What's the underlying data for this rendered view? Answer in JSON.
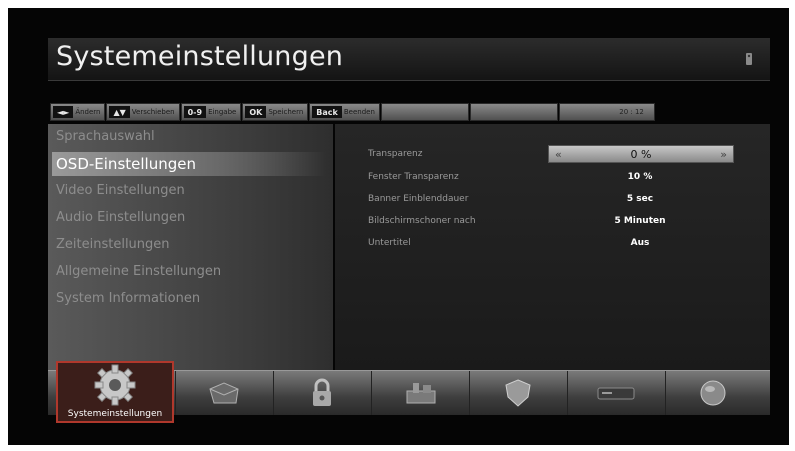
{
  "header": {
    "title": "Systemeinstellungen",
    "corner_icon": "remote-icon"
  },
  "hints": [
    {
      "key": "◄►",
      "label": "Ändern"
    },
    {
      "key": "▲▼",
      "label": "Verschieben"
    },
    {
      "key": "0-9",
      "label": "Eingabe"
    },
    {
      "key": "OK",
      "label": "Speichern"
    },
    {
      "key": "Back",
      "label": "Beenden"
    }
  ],
  "clock": "20 : 12",
  "menu": {
    "items": [
      {
        "label": "Sprachauswahl"
      },
      {
        "label": "OSD-Einstellungen",
        "selected": true
      },
      {
        "label": "Video Einstellungen"
      },
      {
        "label": "Audio Einstellungen"
      },
      {
        "label": "Zeiteinstellungen"
      },
      {
        "label": "Allgemeine Einstellungen"
      },
      {
        "label": "System Informationen"
      }
    ]
  },
  "settings": [
    {
      "label": "Transparenz",
      "value": "0 %"
    },
    {
      "label": "Fenster Transparenz",
      "value": "10 %"
    },
    {
      "label": "Banner Einblenddauer",
      "value": "5 sec"
    },
    {
      "label": "Bildschirmschoner nach",
      "value": "5 Minuten"
    },
    {
      "label": "Untertitel",
      "value": "Aus"
    }
  ],
  "selector": {
    "left": "«",
    "right": "»"
  },
  "dock": {
    "active_label": "Systemeinstellungen",
    "icons": [
      "gear-icon",
      "box-icon",
      "lock-icon",
      "tools-icon",
      "shield-icon",
      "receiver-icon",
      "globe-icon"
    ]
  },
  "colors": {
    "active_border": "#b0382c",
    "selected_row": "#a0a0a0"
  }
}
